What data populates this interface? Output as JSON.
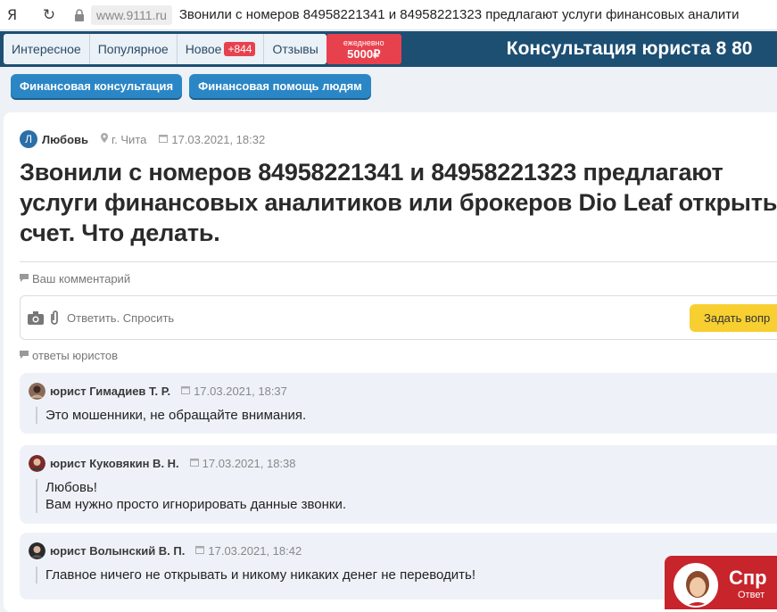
{
  "browser": {
    "logo": "Я",
    "domain": "www.9111.ru",
    "tab_title": "Звонили с номеров 84958221341 и 84958221323 предлагают услуги финансовых аналити"
  },
  "nav": {
    "tabs": [
      "Интересное",
      "Популярное",
      "Новое",
      "Отзывы"
    ],
    "new_badge": "+844",
    "promo_top": "ежедневно",
    "promo_bottom": "5000₽",
    "consult": "Консультация юриста 8 80"
  },
  "categories": [
    "Финансовая консультация",
    "Финансовая помощь людям"
  ],
  "question": {
    "avatar_letter": "Л",
    "author": "Любовь",
    "city": "г. Чита",
    "date": "17.03.2021, 18:32",
    "title": "Звонили с номеров 84958221341 и 84958221323 предлагают услуги финансовых аналитиков или брокеров Dio Leaf открыть счет. Что делать."
  },
  "comment": {
    "label": "Ваш комментарий",
    "placeholder": "Ответить. Спросить",
    "ask_button": "Задать вопр"
  },
  "answers_label": "ответы юристов",
  "answers": [
    {
      "lawyer": "юрист Гимадиев Т. Р.",
      "date": "17.03.2021, 18:37",
      "lines": [
        "Это мошенники, не обращайте внимания."
      ]
    },
    {
      "lawyer": "юрист Куковякин В. Н.",
      "date": "17.03.2021, 18:38",
      "lines": [
        "Любовь!",
        "Вам нужно просто игнорировать данные звонки."
      ]
    },
    {
      "lawyer": "юрист Волынский В. П.",
      "date": "17.03.2021, 18:42",
      "lines": [
        "Главное ничего не открывать и никому никаких денег не переводить!"
      ]
    }
  ],
  "widget": {
    "title": "Спр",
    "sub": "Ответ"
  },
  "colors": {
    "nav_bg": "#1d4f73",
    "category_btn": "#2b86c5",
    "promo": "#e8414e",
    "ask_btn": "#f7cf31",
    "answer_bg": "#eef2f8",
    "widget_bg": "#c8242c"
  }
}
